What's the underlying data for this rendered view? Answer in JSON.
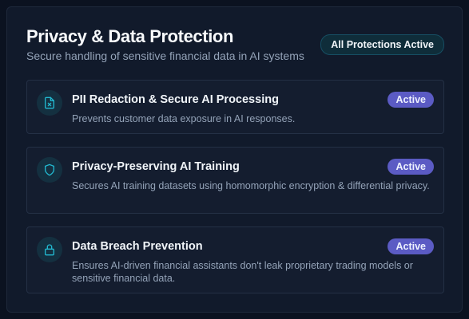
{
  "header": {
    "title": "Privacy & Data Protection",
    "subtitle": "Secure handling of sensitive financial data in AI systems",
    "status": "All Protections Active"
  },
  "cards": [
    {
      "icon": "file-x-icon",
      "title": "PII Redaction & Secure AI Processing",
      "description": "Prevents customer data exposure in AI responses.",
      "badge": "Active"
    },
    {
      "icon": "shield-icon",
      "title": "Privacy-Preserving AI Training",
      "description": "Secures AI training datasets using homomorphic encryption & differential privacy.",
      "badge": "Active"
    },
    {
      "icon": "lock-icon",
      "title": "Data Breach Prevention",
      "description": "Ensures AI-driven financial assistants don't leak proprietary trading models or sensitive financial data.",
      "badge": "Active"
    }
  ],
  "colors": {
    "accent": "#22b8cf",
    "badge": "#5b5bc4"
  }
}
